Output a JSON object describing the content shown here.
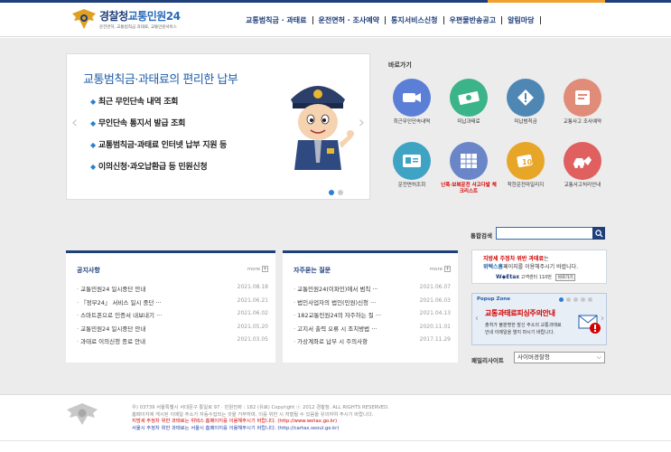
{
  "header": {
    "logo_title_prefix": "경찰청",
    "logo_title_brand": "교통민원24",
    "logo_sub": "운전면허, 교통범칙금 과태료, 교통민원서비스",
    "nav": [
      "교통범칙금 · 과태료",
      "운전면허 · 조사예약",
      "통지서비스신청",
      "우편물반송공고",
      "알림마당"
    ]
  },
  "banner": {
    "title": "교통범칙금·과태료의 편리한 납부",
    "items": [
      "최근 무인단속 내역 조회",
      "무인단속 통지서 발급 조회",
      "교통범칙금·과태료 인터넷 납부 지원 등",
      "이의신청·과오납환급 등 민원신청"
    ],
    "prev": "‹",
    "next": "›"
  },
  "quick": {
    "title": "바로가기",
    "items": [
      {
        "label": "최근무인단속내역",
        "color": "#5b7fd6",
        "icon": "camera-icon"
      },
      {
        "label": "미납과태료",
        "color": "#3bb48a",
        "icon": "money-icon"
      },
      {
        "label": "미납범칙금",
        "color": "#4f87b4",
        "icon": "warning-icon"
      },
      {
        "label": "교통사고 조사예약",
        "color": "#e08c78",
        "icon": "car-crash-icon"
      },
      {
        "label": "운전면허조회",
        "color": "#3fa3c4",
        "icon": "license-icon"
      },
      {
        "label": "난폭·보복운전 사고다발 체크리스트",
        "color": "#6a86c9",
        "icon": "checklist-icon"
      },
      {
        "label": "착한운전마일리지",
        "color": "#e8a628",
        "icon": "mileage-icon"
      },
      {
        "label": "교통사고처리안내",
        "color": "#e06060",
        "icon": "accident-icon"
      }
    ]
  },
  "search": {
    "label": "통합검색",
    "placeholder": ""
  },
  "notice": {
    "title": "공지사항",
    "more": "more",
    "rows": [
      {
        "title": "교통민원24 일시중단 안내",
        "date": "2021.08.18"
      },
      {
        "title": "『정부24』 서비스 일시 중단 ···",
        "date": "2021.06.21"
      },
      {
        "title": "스마트폰으로 인증서 내보내기 ···",
        "date": "2021.06.02"
      },
      {
        "title": "교통민원24 일시중단 안내",
        "date": "2021.05.20"
      },
      {
        "title": "과태료 이의신청 종료 안내",
        "date": "2021.03.05"
      }
    ]
  },
  "faq": {
    "title": "자주묻는 질문",
    "more": "more",
    "rows": [
      {
        "title": "교통민원24(이파인)에서 범칙 ···",
        "date": "2021.06.07"
      },
      {
        "title": "법인사업자의 법인(민원)신청 ···",
        "date": "2021.06.03"
      },
      {
        "title": "182교통민원24의 자주하는 질 ···",
        "date": "2021.04.13"
      },
      {
        "title": "고지서 출력 오류 시 조치방법 ···",
        "date": "2020.11.01"
      },
      {
        "title": "가상계좌로 납부 시 주의사항",
        "date": "2017.11.29"
      }
    ]
  },
  "side_banner": {
    "line1_prefix": "지방세 주정차 위반 과태료는",
    "line1_red": "지방세 주정차 위반 과태료",
    "line1_suffix": "는",
    "line2_brand": "위택스홈",
    "line2_rest": "페이지를 이용해주시기 바랍니다.",
    "wetax": "W◆Etax",
    "center": "고객센터 110번",
    "button": "바로가기"
  },
  "popup_zone": {
    "title": "Popup Zone",
    "headline": "교통과태료피싱주의안내",
    "body_line1": "출처가 불분명한 발신 주소의 교통과태료",
    "body_line2": "안내 이메일을 열지 마시기 바랍니다."
  },
  "family_site": {
    "label": "패밀리사이트",
    "selected": "사이버경찰청"
  },
  "footer": {
    "line1": "우) 03739 서울특별시 서대문구 통일로 97 · 민원전화 : 182 (유료)      Copyright ⓒ 2012 경찰청. ALL RIGHTS RESERVED.",
    "line2": "홈페이지에 게시된 이메일 주소가 자동수집되는 것을 거부하며, 이를 위반 시 처벌될 수 있음을 유의하여 주시기 바랍니다.",
    "line3": "지방세 주정차 위반 과태료는 위택스 홈페이지를 이용해주시기 바랍니다. (http://www.wetax.go.kr)",
    "line4": "서울시 주정차 위반 과태료는 서울시 홈페이지를 이용해주시기 바랍니다. (http://cartax.seoul.go.kr)"
  }
}
